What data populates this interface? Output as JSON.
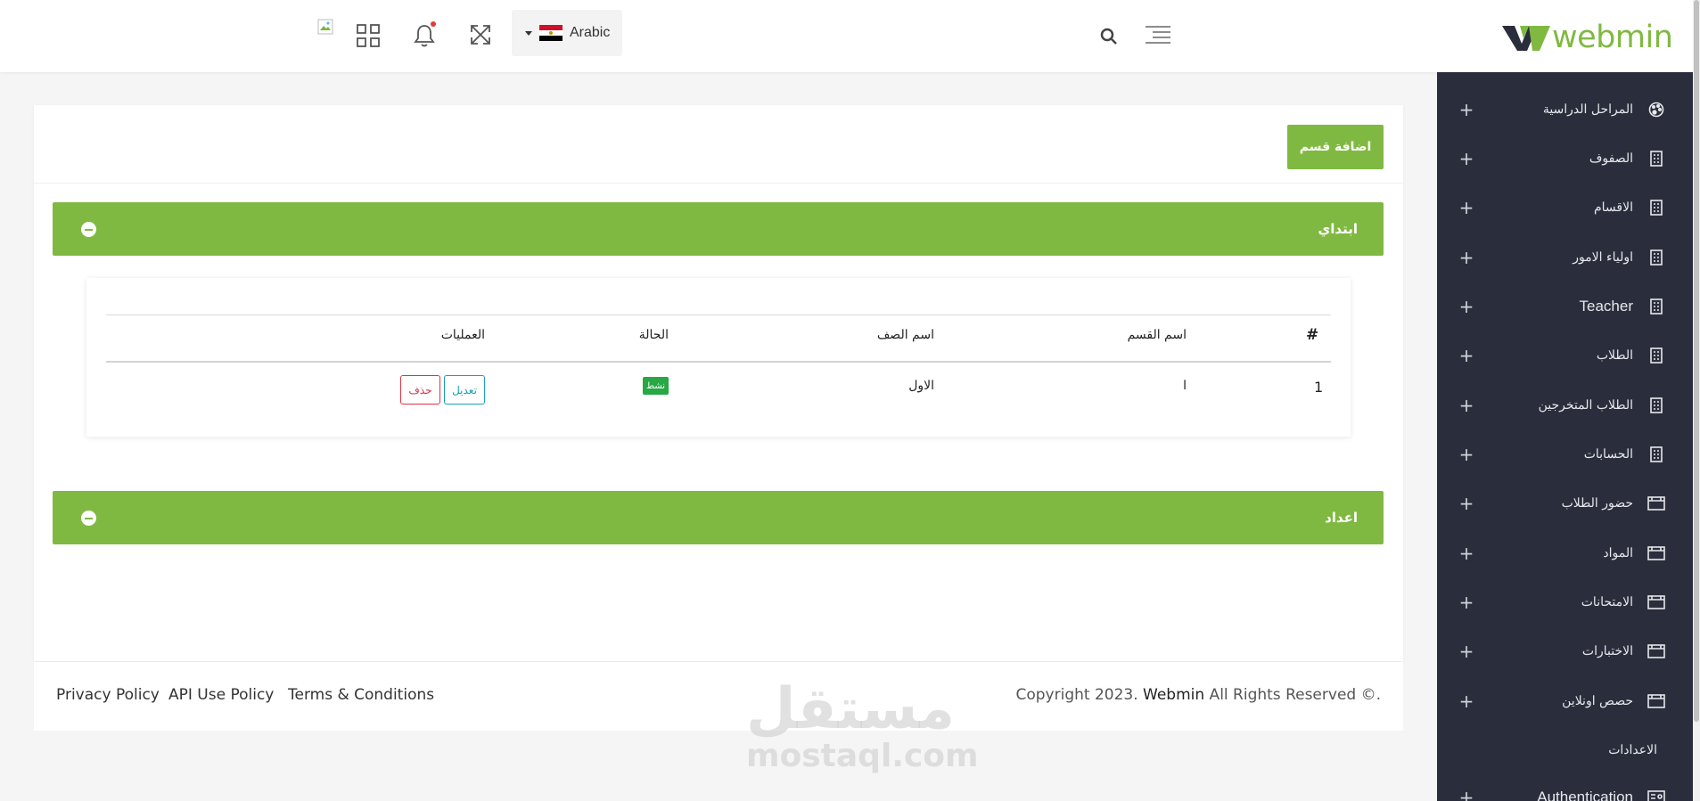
{
  "header": {
    "brand": "webmin",
    "language": "Arabic"
  },
  "sidebar": {
    "items": [
      {
        "label": "المراحل الدراسية",
        "icon": "palette-icon"
      },
      {
        "label": "الصفوف",
        "icon": "building-icon"
      },
      {
        "label": "الاقسام",
        "icon": "building-icon"
      },
      {
        "label": "اولياء الامور",
        "icon": "building-icon"
      },
      {
        "label": "Teacher",
        "icon": "building-icon"
      },
      {
        "label": "الطلاب",
        "icon": "building-icon"
      },
      {
        "label": "الطلاب المتخرجين",
        "icon": "building-icon"
      },
      {
        "label": "الحسابات",
        "icon": "building-icon"
      },
      {
        "label": "حضور الطلاب",
        "icon": "calendar-icon"
      },
      {
        "label": "المواد",
        "icon": "calendar-icon"
      },
      {
        "label": "الامتحانات",
        "icon": "calendar-icon"
      },
      {
        "label": "الاختبارات",
        "icon": "calendar-icon"
      },
      {
        "label": "حصص اونلاين",
        "icon": "calendar-icon"
      },
      {
        "label": "الاعدادات",
        "icon": ""
      },
      {
        "label": "Authentication",
        "icon": "id-card-icon"
      }
    ]
  },
  "main": {
    "add_button": "اضافة قسم",
    "stages": [
      {
        "title": "ابتداي"
      },
      {
        "title": "اعداد"
      }
    ],
    "table": {
      "headers": {
        "index": "#",
        "section_name": "اسم القسم",
        "class_name": "اسم الصف",
        "status": "الحالة",
        "operations": "العمليات"
      },
      "rows": [
        {
          "index": "1",
          "section_name": "ا",
          "class_name": "الاول",
          "status": "نشط",
          "edit": "تعديل",
          "delete": "حذف"
        }
      ]
    }
  },
  "footer": {
    "copyright_prefix": "Copyright 2023. ",
    "copyright_brand": "Webmin",
    "copyright_suffix": " All Rights Reserved ©.",
    "links": [
      "Privacy Policy",
      "API Use Policy",
      "Terms & Conditions"
    ]
  },
  "watermark": {
    "arabic": "مستقل",
    "latin": "mostaql.com"
  },
  "colors": {
    "accent": "#80b942",
    "sidebar_bg": "#2a2e3c",
    "badge_active": "#28a745",
    "edit": "#17a2b8",
    "delete": "#dc3545"
  }
}
